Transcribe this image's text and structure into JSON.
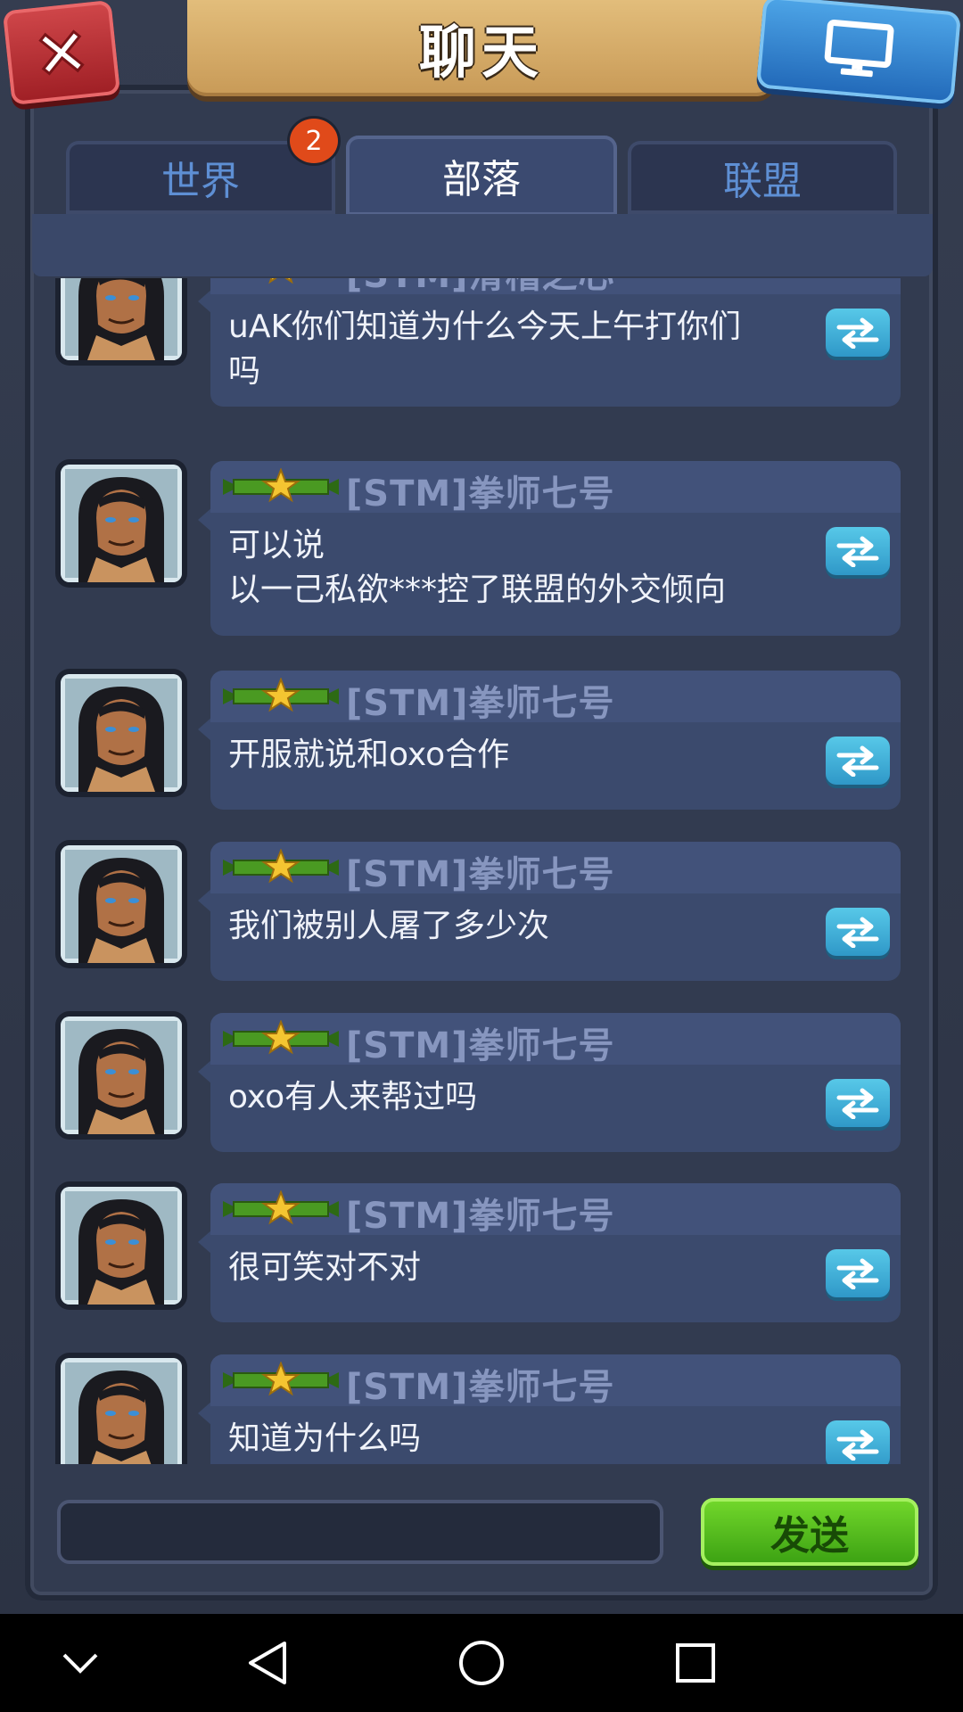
{
  "header": {
    "title": "聊天"
  },
  "tabs": [
    {
      "label": "世界",
      "badge": "2",
      "active": false
    },
    {
      "label": "部落",
      "active": true
    },
    {
      "label": "联盟",
      "active": false
    }
  ],
  "messages": [
    {
      "sender": "[STM]滑稽之心",
      "text": "uAK你们知道为什么今天上午打你们\n吗"
    },
    {
      "sender": "[STM]拳师七号",
      "text": "可以说\n以一己私欲***控了联盟的外交倾向"
    },
    {
      "sender": "[STM]拳师七号",
      "text": "开服就说和oxo合作"
    },
    {
      "sender": "[STM]拳师七号",
      "text": "我们被别人屠了多少次"
    },
    {
      "sender": "[STM]拳师七号",
      "text": "oxo有人来帮过吗"
    },
    {
      "sender": "[STM]拳师七号",
      "text": "很可笑对不对"
    },
    {
      "sender": "[STM]拳师七号",
      "text": "知道为什么吗"
    }
  ],
  "input": {
    "value": "",
    "placeholder": ""
  },
  "send_label": "发送",
  "icons": {
    "close": "close-x-icon",
    "screen": "monitor-icon",
    "reply": "swap-arrows-icon",
    "rank": "star-rank-icon"
  },
  "colors": {
    "accent_blue": "#3b4a6d",
    "send_green": "#5ccb20",
    "close_red": "#c0363b",
    "badge_orange": "#e04a1a"
  }
}
